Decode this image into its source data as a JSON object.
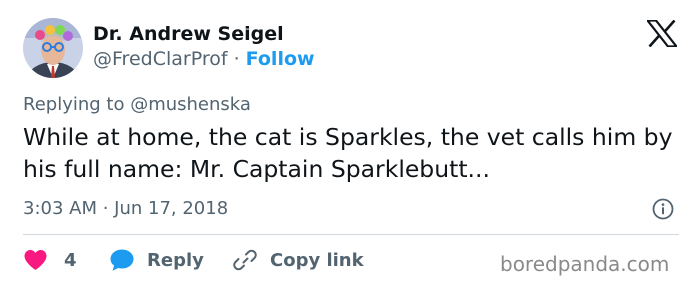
{
  "author": {
    "display_name": "Dr. Andrew Seigel",
    "handle": "@FredClarProf",
    "separator": "·",
    "follow_label": "Follow"
  },
  "reply_context": {
    "text": "Replying to @mushenska"
  },
  "tweet": {
    "text": "While at home, the cat is Sparkles, the vet calls him by his full name: Mr. Captain Sparklebutt...",
    "timestamp": "3:03 AM · Jun 17, 2018"
  },
  "actions": {
    "like_count": "4",
    "reply_label": "Reply",
    "copy_link_label": "Copy link"
  },
  "watermark": "boredpanda.com",
  "icons": {
    "brand": "x-logo-icon",
    "info": "info-icon",
    "like": "heart-icon",
    "reply": "speech-bubble-icon",
    "copy": "link-icon"
  },
  "colors": {
    "text_primary": "#0f1419",
    "text_secondary": "#536471",
    "follow": "#1d9bf0",
    "like": "#f91880",
    "reply": "#1d9bf0",
    "divider": "#cfd9de"
  }
}
